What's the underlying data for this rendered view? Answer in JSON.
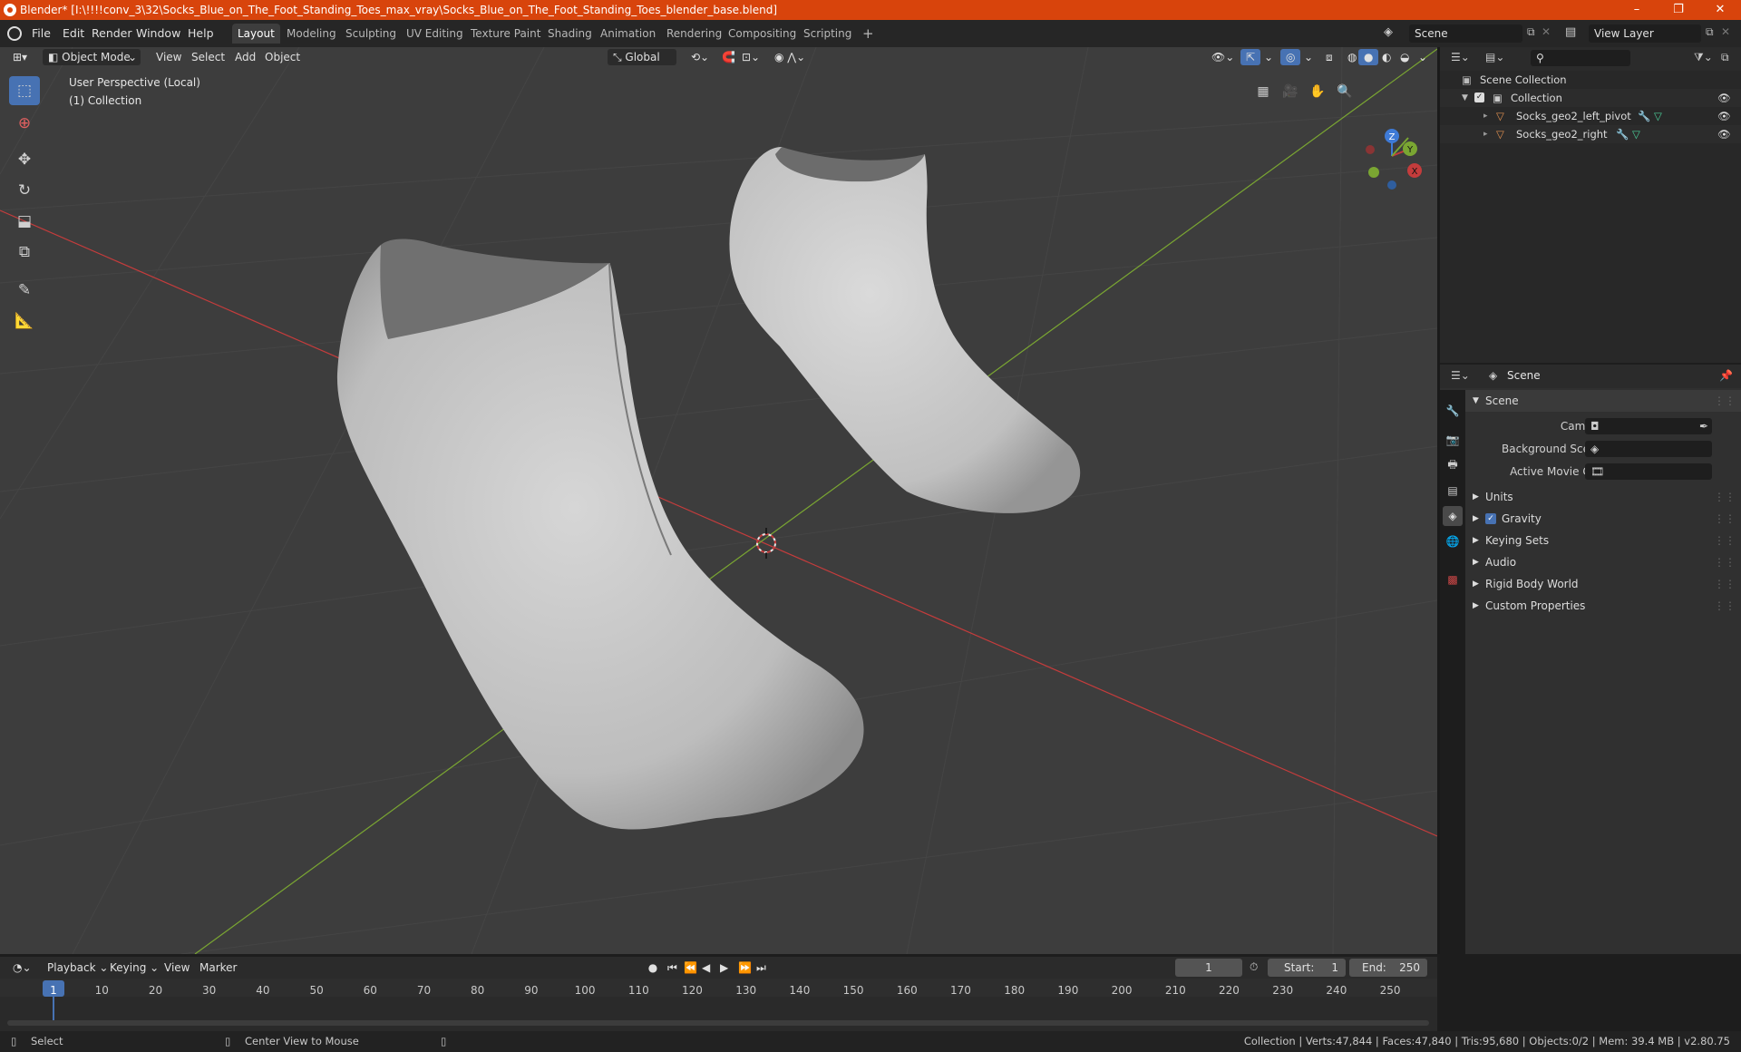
{
  "window": {
    "title": "Blender* [I:\\!!!!conv_3\\32\\Socks_Blue_on_The_Foot_Standing_Toes_max_vray\\Socks_Blue_on_The_Foot_Standing_Toes_blender_base.blend]",
    "minimize": "–",
    "maximize": "❐",
    "close": "✕"
  },
  "menu": {
    "file": "File",
    "edit": "Edit",
    "render": "Render",
    "window": "Window",
    "help": "Help"
  },
  "workspaces": [
    "Layout",
    "Modeling",
    "Sculpting",
    "UV Editing",
    "Texture Paint",
    "Shading",
    "Animation",
    "Rendering",
    "Compositing",
    "Scripting",
    "+"
  ],
  "active_workspace": "Layout",
  "scene_field": "Scene",
  "view_layer_field": "View Layer",
  "viewport": {
    "mode": "Object Mode",
    "menus": [
      "View",
      "Select",
      "Add",
      "Object"
    ],
    "orientation": "Global",
    "perspective_label": "User Perspective (Local)",
    "collection_label": "(1) Collection",
    "gizmo_axes": {
      "x": "X",
      "y": "Y",
      "z": "Z"
    }
  },
  "outliner": {
    "root": "Scene Collection",
    "collection": "Collection",
    "objects": [
      "Socks_geo2_left_pivot",
      "Socks_geo2_right"
    ]
  },
  "properties": {
    "header_title": "Scene",
    "panel_title": "Scene",
    "camera_label": "Camera",
    "background_scene_label": "Background Scene",
    "active_movie_clip_label": "Active Movie Clip",
    "sections": [
      "Units",
      "Gravity",
      "Keying Sets",
      "Audio",
      "Rigid Body World",
      "Custom Properties"
    ],
    "gravity_checked": true
  },
  "timeline": {
    "menus": [
      "Playback",
      "Keying",
      "View",
      "Marker"
    ],
    "current_frame": "1",
    "start_label": "Start:",
    "start_value": "1",
    "end_label": "End:",
    "end_value": "250",
    "ticks": [
      "1",
      "10",
      "20",
      "30",
      "40",
      "50",
      "60",
      "70",
      "80",
      "90",
      "100",
      "110",
      "120",
      "130",
      "140",
      "150",
      "160",
      "170",
      "180",
      "190",
      "200",
      "210",
      "220",
      "230",
      "240",
      "250"
    ]
  },
  "statusbar": {
    "left_action": "Select",
    "middle_action": "Center View to Mouse",
    "stats": "Collection | Verts:47,844 | Faces:47,840 | Tris:95,680 | Objects:0/2 | Mem: 39.4 MB | v2.80.75"
  },
  "colors": {
    "title_bar": "#d8440c",
    "accent": "#4772b3",
    "x_axis": "#c43c3c",
    "y_axis": "#7aa632",
    "z_axis": "#3e7ad6"
  }
}
